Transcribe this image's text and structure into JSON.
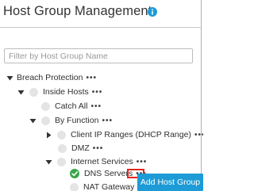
{
  "header": {
    "title": "Host Group Management"
  },
  "filter": {
    "placeholder": "Filter by Host Group Name",
    "value": ""
  },
  "tree": {
    "more_label": "•••",
    "nodes": [
      {
        "label": "Breach Protection",
        "caret": "expanded",
        "icon": "none",
        "more": true
      },
      {
        "label": "Inside Hosts",
        "caret": "expanded",
        "icon": "circle",
        "more": true
      },
      {
        "label": "Catch All",
        "caret": "none",
        "icon": "circle",
        "more": true
      },
      {
        "label": "By Function",
        "caret": "expanded",
        "icon": "circle",
        "more": true
      },
      {
        "label": "Client IP Ranges (DHCP Range)",
        "caret": "collapsed",
        "icon": "circle",
        "more": true
      },
      {
        "label": "DMZ",
        "caret": "none",
        "icon": "circle",
        "more": true
      },
      {
        "label": "Internet Services",
        "caret": "expanded",
        "icon": "circle",
        "more": true
      },
      {
        "label": "DNS Servers",
        "caret": "none",
        "icon": "check",
        "more": true
      },
      {
        "label": "NAT Gateway",
        "caret": "none",
        "icon": "circle",
        "more": false
      }
    ]
  },
  "action": {
    "add_host_group": "Add Host Group"
  },
  "colors": {
    "accent": "#1d9bd6",
    "check": "#3aa64a",
    "highlight": "#e0251b"
  }
}
